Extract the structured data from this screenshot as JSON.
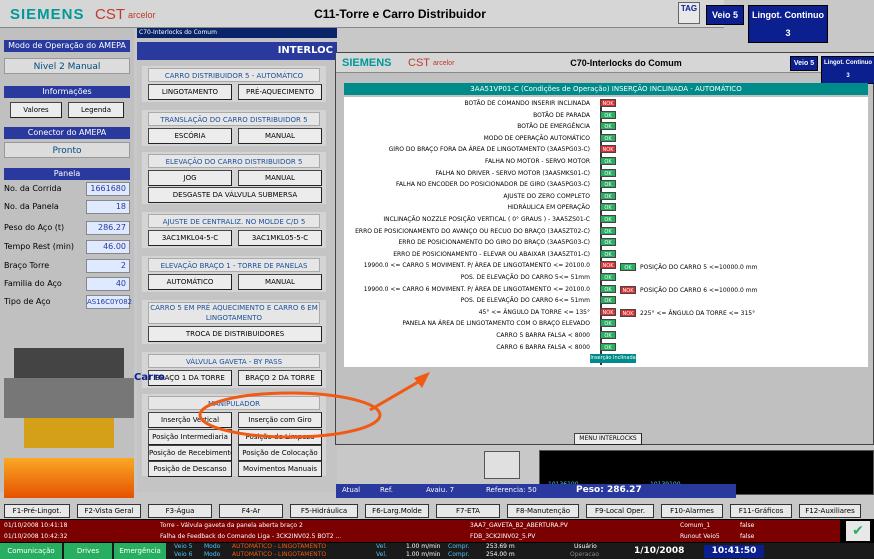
{
  "header": {
    "brand": "SIEMENS",
    "cst": "CST",
    "arcelor": "arcelor",
    "title": "C11-Torre e Carro Distribuidor",
    "veio": "Veio 5",
    "lingot": "Lingot. Continuo 3",
    "tag": "TAG"
  },
  "left": {
    "modo_title": "Modo de Operação do AMEPA",
    "modo_val": "Nivel 2 Manual",
    "info_title": "Informações",
    "valores": "Valores",
    "legenda": "Legenda",
    "conector_title": "Conector do AMEPA",
    "conector_val": "Pronto",
    "panela_title": "Panela",
    "fields": [
      {
        "label": "No. da Corrida",
        "value": "1661680"
      },
      {
        "label": "No. da Panela",
        "value": "18"
      },
      {
        "label": "Peso do Aço (t)",
        "value": "286.27"
      },
      {
        "label": "Tempo Rest (min)",
        "value": "46.00"
      },
      {
        "label": "Braço Torre",
        "value": "2"
      },
      {
        "label": "Familia do Aço",
        "value": "40"
      },
      {
        "label": "Tipo de Aço",
        "value": "AS16C0Y082"
      }
    ]
  },
  "center": {
    "window_title": "C70-Interlocks do Comum",
    "header": "INTERLOC",
    "s1": "CARRO DISTRIBUIDOR 5 - AUTOMÁTICO",
    "b1a": "LINGOTAMENTO",
    "b1b": "PRÉ-AQUECIMENTO",
    "s2": "TRANSLAÇÃO DO CARRO DISTRIBUIDOR 5",
    "b2a": "ESCÓRIA",
    "b2b": "MANUAL",
    "s3": "ELEVAÇÃO DO CARRO DISTRIBUIDOR 5",
    "b3a": "JOG",
    "b3b": "MANUAL",
    "b3c": "DESGASTE DA VÁLVULA SUBMERSA",
    "s4": "AJUSTE DE CENTRALIZ. NO MOLDE C/D 5",
    "b4a": "3AC1MKL04-5-C",
    "b4b": "3AC1MKL05-5-C",
    "s5": "ELEVAÇÃO BRAÇO 1 - TORRE DE PANELAS",
    "b5a": "AUTOMÁTICO",
    "b5b": "MANUAL",
    "s6": "CARRO 5 EM PRÉ AQUECIMENTO E CARRO 6 EM LINGOTAMENTO",
    "b6": "TROCA DE DISTRIBUIDORES",
    "s7": "VÁLVULA GAVETA - BY PASS",
    "b7a": "BRAÇO 1 DA TORRE",
    "b7b": "BRAÇO 2 DA TORRE",
    "s8": "MANIPULADOR",
    "b8a": "Inserção Vertical",
    "b8b": "Inserção com Giro",
    "b8c": "Posição Intermediaria",
    "b8d": "Posição de Limpeza",
    "b8e": "Posição de Recebimento",
    "b8f": "Posição de Colocação",
    "b8g": "Posição de Descanso",
    "b8h": "Movimentos Manuais",
    "carro": "Carro"
  },
  "popup": {
    "brand": "SIEMENS",
    "cst": "CST",
    "arcelor": "arcelor",
    "title": "C70-Interlocks do Comum",
    "veio": "Veio 5",
    "lingot": "Lingot. Continuo 3",
    "subtitle": "3AA51VP01-C (Condições de Operação) INSERÇÃO INCLINADA - AUTOMÁTICO",
    "rows": [
      {
        "t": "BOTÃO DE COMANDO INSERIR INCLINADA",
        "s": "NOK"
      },
      {
        "t": "BOTÃO DE PARADA",
        "s": "OK"
      },
      {
        "t": "BOTÃO DE EMERGÊNCIA",
        "s": "OK"
      },
      {
        "t": "MODO DE OPERAÇÃO AUTOMÁTICO",
        "s": "OK"
      },
      {
        "t": "GIRO DO BRAÇO FORA DA ÁREA DE LINGOTAMENTO (3AA5PG03-C)",
        "s": "NOK"
      },
      {
        "t": "FALHA NO MOTOR - SERVO MOTOR",
        "s": "OK"
      },
      {
        "t": "FALHA NO DRIVER - SERVO MOTOR (3AA5MKS01-C)",
        "s": "OK"
      },
      {
        "t": "FALHA NO ENCODER DO POSICIONADOR DE GIRO (3AA5PG03-C)",
        "s": "OK"
      },
      {
        "t": "AJUSTE DO ZERO COMPLETO",
        "s": "OK"
      },
      {
        "t": "HIDRÁULICA EM OPERAÇÃO",
        "s": "OK"
      },
      {
        "t": "INCLINAÇÃO NOZZLE POSIÇÃO VERTICAL ( 0° GRAUS ) - 3AA5ZS01-C",
        "s": "OK"
      },
      {
        "t": "ERRO DE POSICIONAMENTO DO AVANÇO OU RECUO DO BRAÇO (3AA5ZT02-C)",
        "s": "OK"
      },
      {
        "t": "ERRO DE POSICIONAMENTO DO GIRO DO BRAÇO (3AA5PG03-C)",
        "s": "OK"
      },
      {
        "t": "ERRO DE POSICIONAMENTO - ELEVAR OU ABAIXAR (3AA5ZT01-C)",
        "s": "OK"
      },
      {
        "t": "19900.0 <= CARRO 5 MOVIMENT. P/ ÁREA DE LINGOTAMENTO <= 20100.0",
        "s": "NOK"
      },
      {
        "t": "POS. DE ELEVAÇÃO DO CARRO 5<= 51mm",
        "s": "OK"
      },
      {
        "t": "19900.0 <= CARRO 6 MOVIMENT. P/ ÁREA DE LINGOTAMENTO <= 20100.0",
        "s": "OK"
      },
      {
        "t": "POS. DE ELEVAÇÃO DO CARRO 6<= 51mm",
        "s": "OK"
      },
      {
        "t": "45° <= ÂNGULO DA TORRE <= 135°",
        "s": "NOK"
      },
      {
        "t": "PANELA NA ÁREA DE LINGOTAMENTO COM O BRAÇO ELEVADO",
        "s": "OK"
      },
      {
        "t": "CARRO 5 BARRA FALSA < 8000",
        "s": "OK"
      },
      {
        "t": "CARRO 6 BARRA FALSA < 8000",
        "s": "OK"
      }
    ],
    "side": [
      {
        "t": "POSIÇÃO DO CARRO 5 <=10000.0 mm",
        "s": "OK"
      },
      {
        "t": "POSIÇÃO DO CARRO 6 <=10000.0 mm",
        "s": "NOK"
      },
      {
        "t": "225° <= ÂNGULO DA TORRE <= 315°",
        "s": "NOK"
      }
    ],
    "result": "Inserção Inclinada",
    "menu": "MENU INTERLOCKS",
    "trend1": "10136100",
    "trend2": "10139100"
  },
  "bottom_vals": {
    "atual": "Atual",
    "ref": "Ref.",
    "avaiu": "Avaiu. 7",
    "referencia": "Referencia: 50",
    "peso": "Peso: 286.27"
  },
  "fkeys": [
    "F1-Pré-Lingot.",
    "F2-Vista Geral",
    "F3-Água",
    "F4-Ar",
    "F5-Hidráulica",
    "F6-Larg.Molde",
    "F7-ETA",
    "F8-Manutenção",
    "F9-Local Oper.",
    "F10-Alarmes",
    "F11-Gráficos",
    "F12-Auxiliares"
  ],
  "alarms": [
    {
      "date": "01/10/2008 10:41:18",
      "msg": "Torre - Válvula gaveta da panela aberta braço 2",
      "tag": "3AA7_GAVETA_B2_ABERTURA.PV",
      "src": "Comum_1",
      "v": "false"
    },
    {
      "date": "01/10/2008 10:42:32",
      "msg": "Falha de Feedback do Comando Liga - 3CK2INV02.5 BOT2 ...",
      "tag": "FDB_3CK2INV02_5.PV",
      "src": "Runout Veio5",
      "v": "false"
    }
  ],
  "status": {
    "com": "Comunicação",
    "drives": "Drives",
    "emerg": "Emergência",
    "v5": "Veio 5",
    "v6": "Veio 6",
    "modo": "Modo",
    "auto": "AUTOMÁTICO - LINGOTAMENTO",
    "vel": "Vel.",
    "speed": "1.00 m/min",
    "compr": "Compr.",
    "c5": "253.69 m",
    "c6": "254.00 m",
    "usuario": "Usuário",
    "oper": "Operacao",
    "date": "1/10/2008",
    "time": "10:41:50"
  },
  "colors": {
    "blue": "#29399e",
    "teal": "#008b8b",
    "ok": "#27ae60",
    "nok": "#d63031",
    "orange": "#f05a14"
  }
}
